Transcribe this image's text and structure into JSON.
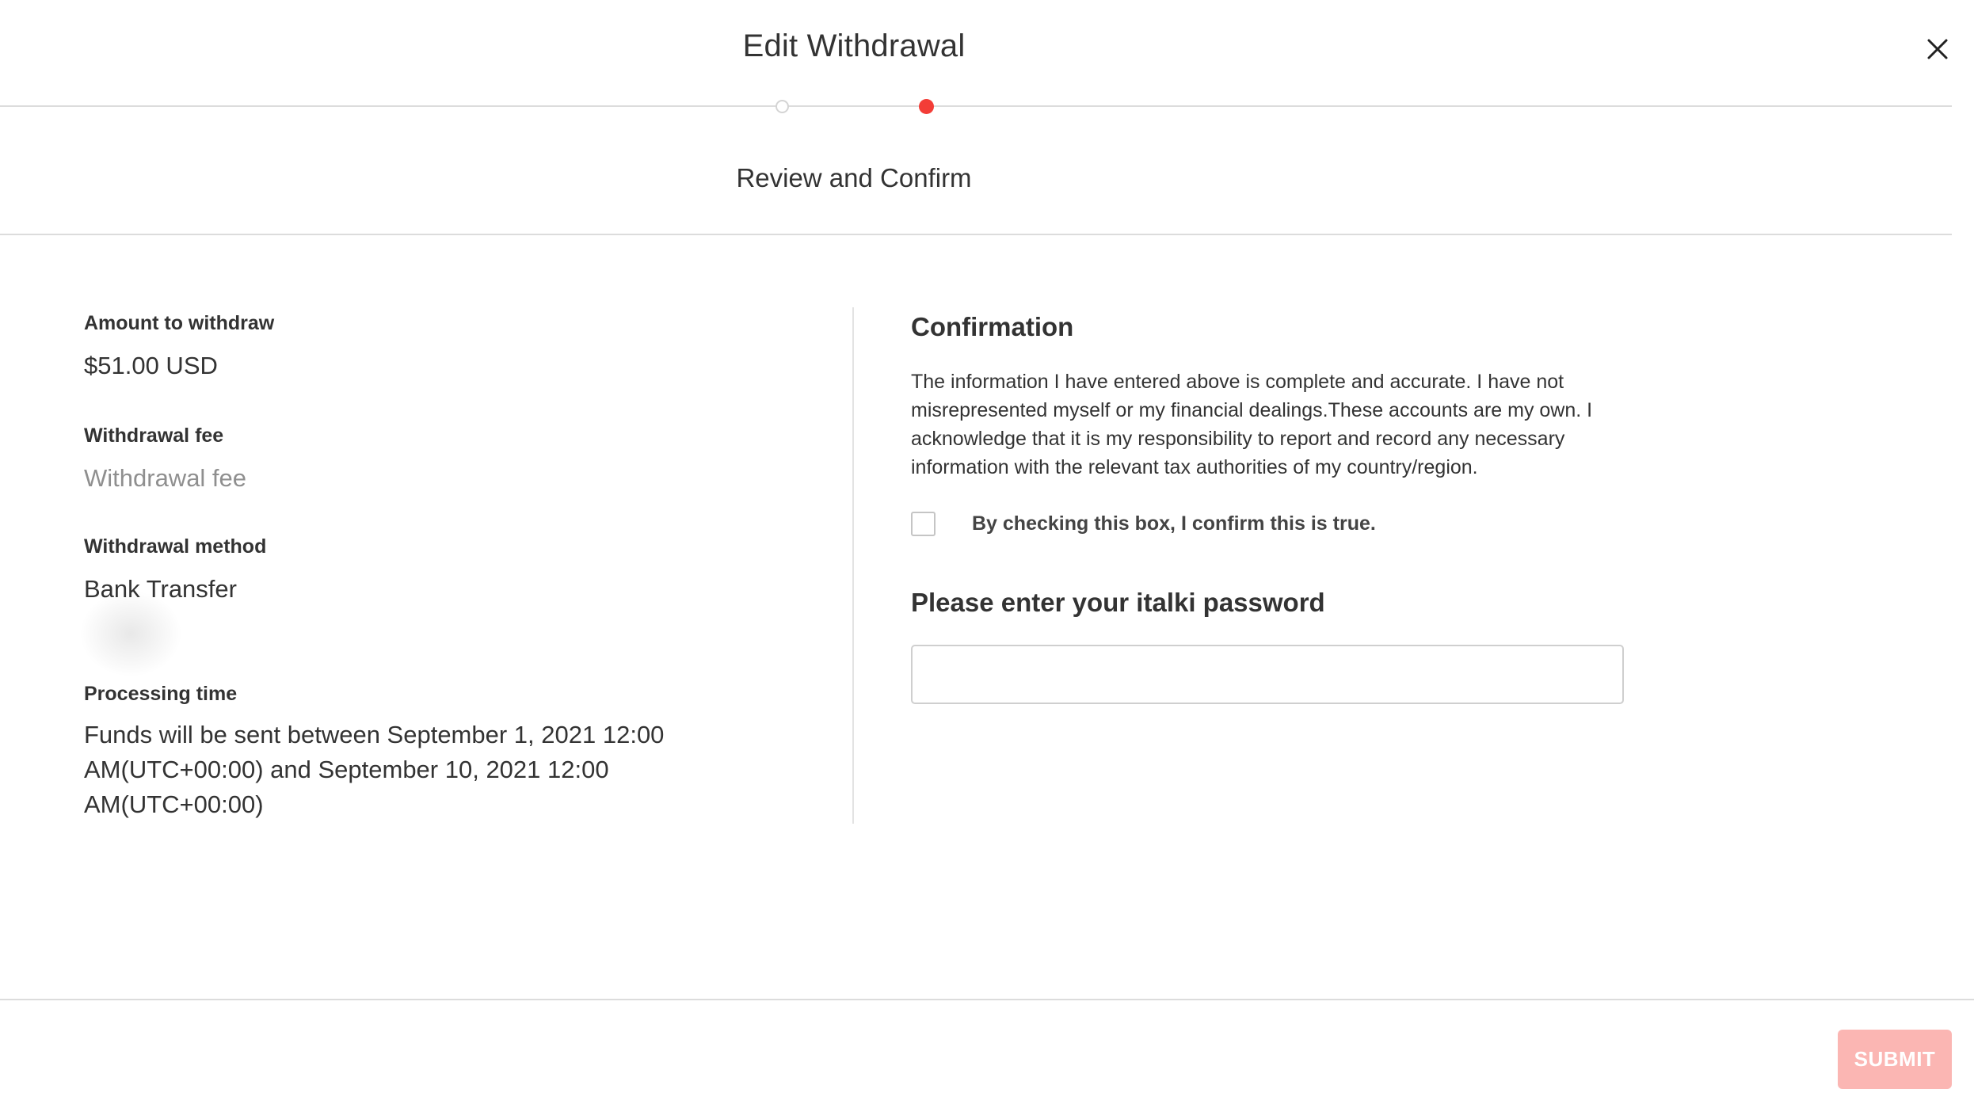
{
  "modal": {
    "title": "Edit Withdrawal",
    "close_icon": "close-icon"
  },
  "stepper": {
    "steps": [
      {
        "state": "inactive"
      },
      {
        "state": "active",
        "color": "#f33d37"
      }
    ],
    "current_step_label": "Review and Confirm"
  },
  "details": {
    "amount_label": "Amount to withdraw",
    "amount_value": "$51.00 USD",
    "fee_label": "Withdrawal fee",
    "fee_value": "Withdrawal fee",
    "method_label": "Withdrawal method",
    "method_value": "Bank Transfer",
    "processing_label": "Processing time",
    "processing_value": "Funds will be sent between September 1, 2021 12:00 AM(UTC+00:00) and September 10, 2021 12:00 AM(UTC+00:00)"
  },
  "confirmation": {
    "heading": "Confirmation",
    "text": "The information I have entered above is complete and accurate. I have not misrepresented myself or my financial dealings.These accounts are my own. I acknowledge that it is my responsibility to report and record any necessary information with the relevant tax authorities of my country/region.",
    "checkbox_label": "By checking this box, I confirm this is true.",
    "checkbox_checked": false,
    "password_heading": "Please enter your italki password",
    "password_value": ""
  },
  "footer": {
    "submit_label": "SUBMIT",
    "submit_enabled": false,
    "submit_color": "#fbb6b3"
  }
}
